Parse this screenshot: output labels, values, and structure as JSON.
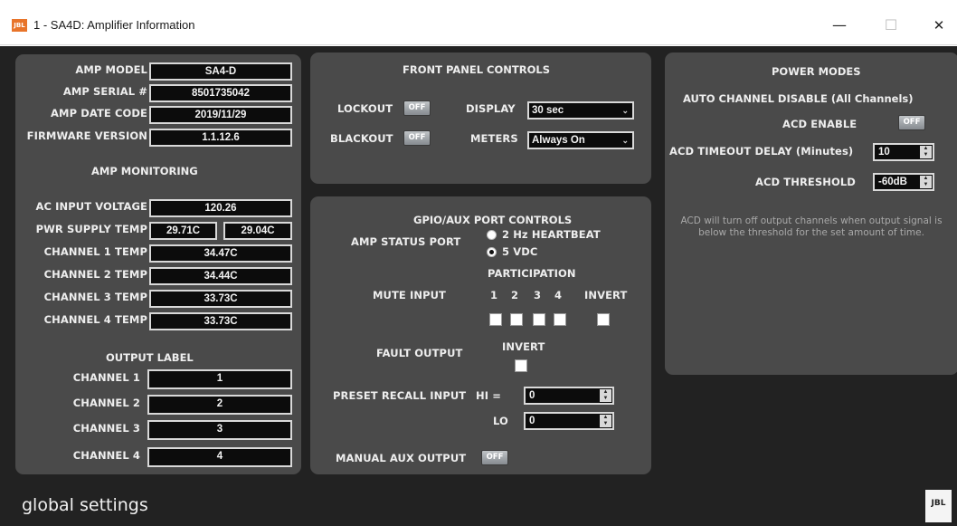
{
  "window": {
    "title": "1 - SA4D: Amplifier Information",
    "icon_text": "JBL",
    "minimize": "—",
    "maximize": "☐",
    "close": "✕"
  },
  "amp_info": {
    "labels": {
      "model": "AMP MODEL",
      "serial": "AMP SERIAL #",
      "date_code": "AMP DATE CODE",
      "firmware": "FIRMWARE VERSION"
    },
    "values": {
      "model": "SA4-D",
      "serial": "8501735042",
      "date_code": "2019/11/29",
      "firmware": "1.1.12.6"
    }
  },
  "monitoring": {
    "header": "AMP MONITORING",
    "ac_input_label": "AC INPUT VOLTAGE",
    "ac_input_value": "120.26",
    "pwr_supply_label": "PWR SUPPLY TEMP",
    "pwr_supply_values": [
      "29.71C",
      "29.04C"
    ],
    "channels": [
      {
        "label": "CHANNEL 1 TEMP",
        "value": "34.47C"
      },
      {
        "label": "CHANNEL 2 TEMP",
        "value": "34.44C"
      },
      {
        "label": "CHANNEL 3 TEMP",
        "value": "33.73C"
      },
      {
        "label": "CHANNEL 4 TEMP",
        "value": "33.73C"
      }
    ]
  },
  "output_label": {
    "header": "OUTPUT LABEL",
    "channels": [
      {
        "label": "CHANNEL 1",
        "value": "1"
      },
      {
        "label": "CHANNEL 2",
        "value": "2"
      },
      {
        "label": "CHANNEL 3",
        "value": "3"
      },
      {
        "label": "CHANNEL 4",
        "value": "4"
      }
    ]
  },
  "front_panel": {
    "header": "FRONT PANEL CONTROLS",
    "lockout_label": "LOCKOUT",
    "lockout_state": "OFF",
    "blackout_label": "BLACKOUT",
    "blackout_state": "OFF",
    "display_label": "DISPLAY",
    "display_value": "30 sec",
    "meters_label": "METERS",
    "meters_value": "Always On",
    "chevron": "⌄"
  },
  "gpio": {
    "header": "GPIO/AUX PORT CONTROLS",
    "status_port_label": "AMP STATUS PORT",
    "status_options": [
      "2 Hz HEARTBEAT",
      "5 VDC"
    ],
    "status_selected": "5 VDC",
    "participation_label": "PARTICIPATION",
    "mute_input_label": "MUTE INPUT",
    "participation_channels": [
      "1",
      "2",
      "3",
      "4"
    ],
    "invert_label": "INVERT",
    "fault_output_label": "FAULT OUTPUT",
    "fault_invert_label": "INVERT",
    "preset_recall_label": "PRESET RECALL INPUT",
    "hi_label": "HI =",
    "hi_value": "0",
    "lo_label": "LO",
    "lo_value": "0",
    "manual_aux_label": "MANUAL AUX OUTPUT",
    "manual_aux_state": "OFF"
  },
  "power_modes": {
    "header": "POWER MODES",
    "subheader": "AUTO CHANNEL DISABLE (All Channels)",
    "acd_enable_label": "ACD ENABLE",
    "acd_enable_state": "OFF",
    "timeout_label": "ACD TIMEOUT DELAY (Minutes)",
    "timeout_value": "10",
    "threshold_label": "ACD THRESHOLD",
    "threshold_value": "-60dB",
    "note": "ACD will turn off output channels when output signal is below the threshold for the set amount of time."
  },
  "footer": {
    "title": "global settings",
    "logo_text": "JBL"
  },
  "spin_arrows": {
    "up": "▲",
    "down": "▼"
  }
}
